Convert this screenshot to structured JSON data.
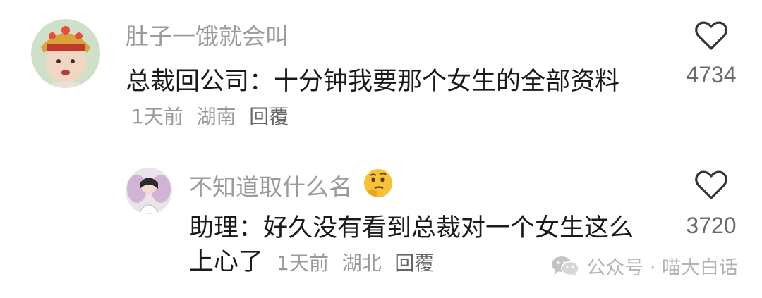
{
  "comments": [
    {
      "username": "肚子一饿就会叫",
      "content": "总裁回公司：十分钟我要那个女生的全部资料",
      "time": "1天前",
      "location": "湖南",
      "reply_label": "回覆",
      "like_count": "4734",
      "avatar": "tang-monk-avatar",
      "like_icon": "heart-outline-icon"
    },
    {
      "username": "不知道取什么名",
      "username_emoji": "thinking-face-emoji",
      "content": "助理：好久没有看到总裁对一个女生这么上心了",
      "time": "1天前",
      "location": "湖北",
      "reply_label": "回覆",
      "like_count": "3720",
      "avatar": "fairy-wings-avatar",
      "like_icon": "heart-outline-icon"
    }
  ],
  "watermark": {
    "text": "公众号 · 喵大白话",
    "icon": "wechat-icon"
  },
  "colors": {
    "username": "#9b9b9b",
    "content": "#1a1a1a",
    "meta": "#999999",
    "heart": "#333333",
    "like_count": "#6b6b6b",
    "watermark": "#b3b3b3"
  }
}
